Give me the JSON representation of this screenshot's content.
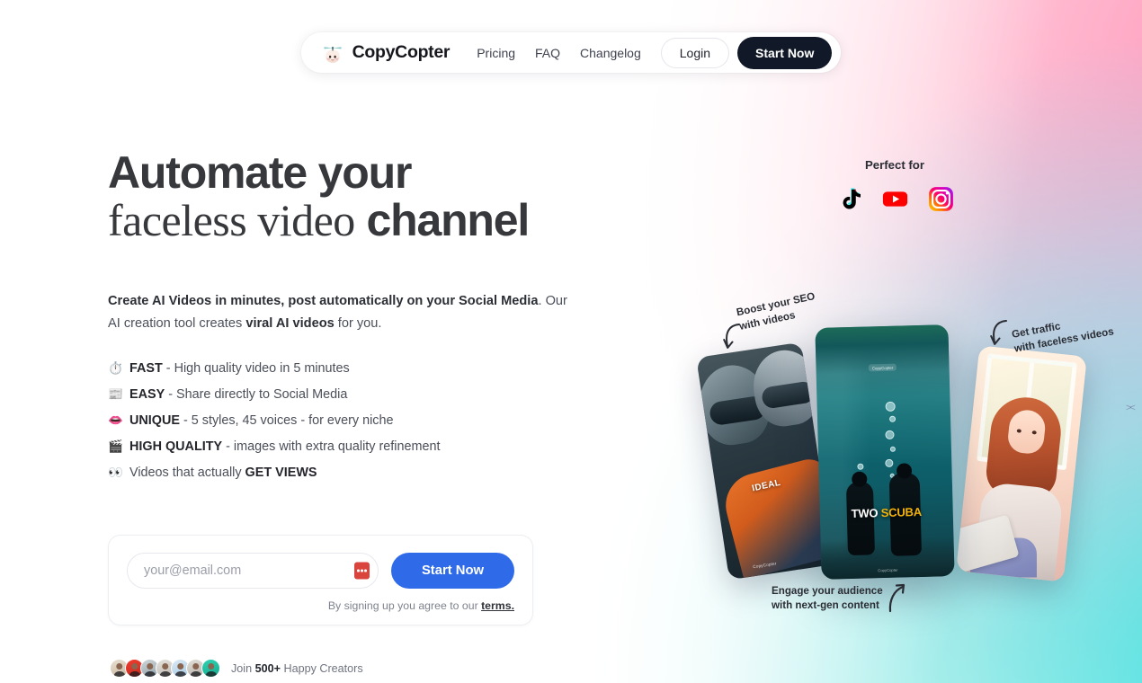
{
  "nav": {
    "brand": "CopyCopter",
    "brand_icon": "helicopter-egg-logo",
    "links": [
      {
        "label": "Pricing",
        "name": "nav-link-pricing"
      },
      {
        "label": "FAQ",
        "name": "nav-link-faq"
      },
      {
        "label": "Changelog",
        "name": "nav-link-changelog"
      }
    ],
    "login_label": "Login",
    "start_label": "Start Now"
  },
  "hero": {
    "headline_line1": "Automate your",
    "headline_line2_serif": "faceless video",
    "headline_line2_bold": "channel",
    "subhead_part1": "Create AI Videos in minutes, post automatically on your Social Media",
    "subhead_part2": ". Our AI creation tool creates ",
    "subhead_bold": "viral AI videos",
    "subhead_part3": " for you.",
    "features": [
      {
        "emoji": "⏱️",
        "icon_name": "stopwatch-icon",
        "bold": "FAST",
        "rest": " - High quality video in 5 minutes"
      },
      {
        "emoji": "📰",
        "icon_name": "newspaper-icon",
        "bold": "EASY",
        "rest": " - Share directly to Social Media"
      },
      {
        "emoji": "👄",
        "icon_name": "lips-icon",
        "bold": "UNIQUE",
        "rest": " - 5 styles, 45 voices - for every niche"
      },
      {
        "emoji": "🎬",
        "icon_name": "clapper-board-icon",
        "bold": "HIGH QUALITY",
        "rest": " - images with extra quality refinement"
      },
      {
        "emoji": "👀",
        "icon_name": "eyes-icon",
        "bold": "",
        "rest": "Videos that actually ",
        "trailing_bold": "GET VIEWS"
      }
    ]
  },
  "signup": {
    "email_placeholder": "your@email.com",
    "email_value": "",
    "password_manager_icon": "password-manager-autofill-icon",
    "submit_label": "Start Now",
    "terms_prefix": "By signing up you agree to our ",
    "terms_link": "terms."
  },
  "social_proof": {
    "prefix": "Join ",
    "count": "500+",
    "suffix": " Happy Creators",
    "avatar_count": 7
  },
  "perfect_for": {
    "label": "Perfect for",
    "platforms": [
      {
        "name": "tiktok-icon",
        "label": "TikTok"
      },
      {
        "name": "youtube-icon",
        "label": "YouTube"
      },
      {
        "name": "instagram-icon",
        "label": "Instagram"
      }
    ]
  },
  "annotations": {
    "seo_line1": "Boost your SEO",
    "seo_line2": "with videos",
    "traffic_line1": "Get traffic",
    "traffic_line2": "with faceless videos",
    "engage_line1": "Engage your audience",
    "engage_line2": "with next-gen content"
  },
  "phones": {
    "left": {
      "name": "phone-mockup-racing",
      "overlay_text": "IDEAL",
      "watermark": "CopyCopter"
    },
    "center": {
      "name": "phone-mockup-scuba",
      "caption_white": "TWO ",
      "caption_yellow": "SCUBA",
      "watermark": "CopyCopter"
    },
    "right": {
      "name": "phone-mockup-illustration"
    }
  },
  "colors": {
    "nav_cta": "#111827",
    "form_cta": "#2f6ae8",
    "heading": "#36383c",
    "body_text": "#4b4f59",
    "accent_pink": "#ff96b9",
    "accent_cyan": "#38e0de",
    "youtube_red": "#ff0000",
    "caption_yellow": "#f3b308",
    "autofill_red": "#d9453c"
  }
}
